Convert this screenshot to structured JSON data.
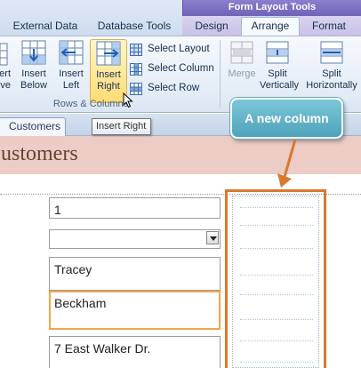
{
  "ribbon_tabs": {
    "contextual_title": "Form Layout Tools",
    "tabs": [
      "External Data",
      "Database Tools",
      "Design",
      "Arrange",
      "Format"
    ],
    "active": "Arrange"
  },
  "ribbon": {
    "insert_above": [
      "Insert",
      "Above"
    ],
    "insert_below": [
      "Insert",
      "Below"
    ],
    "insert_left": [
      "Insert",
      "Left"
    ],
    "insert_right": [
      "Insert",
      "Right"
    ],
    "select_layout": "Select Layout",
    "select_column": "Select Column",
    "select_row": "Select Row",
    "group_label": "Rows & Columns",
    "merge": "Merge",
    "split_vertically": [
      "Split",
      "Vertically"
    ],
    "split_horizontally": [
      "Split",
      "Horizontally"
    ]
  },
  "tooltip": "Insert Right",
  "document_tab": "Customers",
  "form_title": "Customers",
  "fields": {
    "id": "1",
    "dropdown": "",
    "first_name": "Tracey",
    "last_name": "Beckham",
    "address": "7 East Walker Dr."
  },
  "callout": "A new column",
  "colors": {
    "ribbon_bg": "#e5edf7",
    "contextual_band": "#7c70c4",
    "form_header": "#ecccc5",
    "highlight_orange": "#d9792e",
    "callout_teal": "#5bb0c6"
  }
}
